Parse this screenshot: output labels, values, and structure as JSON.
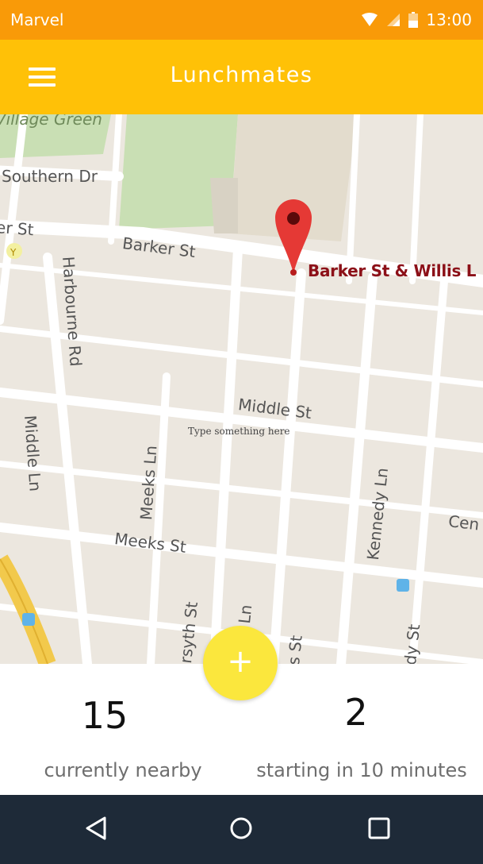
{
  "status_bar": {
    "app_name": "Marvel",
    "time": "13:00",
    "icons": [
      "wifi-icon",
      "cellular-signal-icon",
      "battery-icon"
    ]
  },
  "app_bar": {
    "title": "Lunchmates",
    "menu_icon": "hamburger-menu-icon"
  },
  "map": {
    "street_labels": {
      "village_green": "Village Green",
      "southern_dr": "Southern Dr",
      "er_st": "er St",
      "barker_st": "Barker St",
      "harbourne_rd": "Harbourne Rd",
      "middle_st": "Middle St",
      "middle_ln": "Middle Ln",
      "meeks_ln": "Meeks Ln",
      "meeks_st": "Meeks St",
      "kennedy_ln": "Kennedy Ln",
      "cen": "Cen",
      "forsyth_st": "rsyth St",
      "ln_fragment": "Ln",
      "s_st": "s St",
      "dy_st": "dy St"
    },
    "pin_label": "Barker St & Willis L",
    "input_placeholder": "Type something here",
    "input_value": ""
  },
  "fab": {
    "label": "+"
  },
  "stats": {
    "nearby": {
      "value": "15",
      "label": "currently nearby"
    },
    "starting": {
      "value": "2",
      "label": "starting in 10 minutes"
    }
  },
  "nav_bar": {
    "icons": [
      "back-icon",
      "home-icon",
      "recents-icon"
    ]
  },
  "colors": {
    "status_bar": "#f99a08",
    "app_bar": "#ffc107",
    "fab": "#fbe73d",
    "nav_bar": "#1e2a38",
    "pin": "#e53935"
  }
}
